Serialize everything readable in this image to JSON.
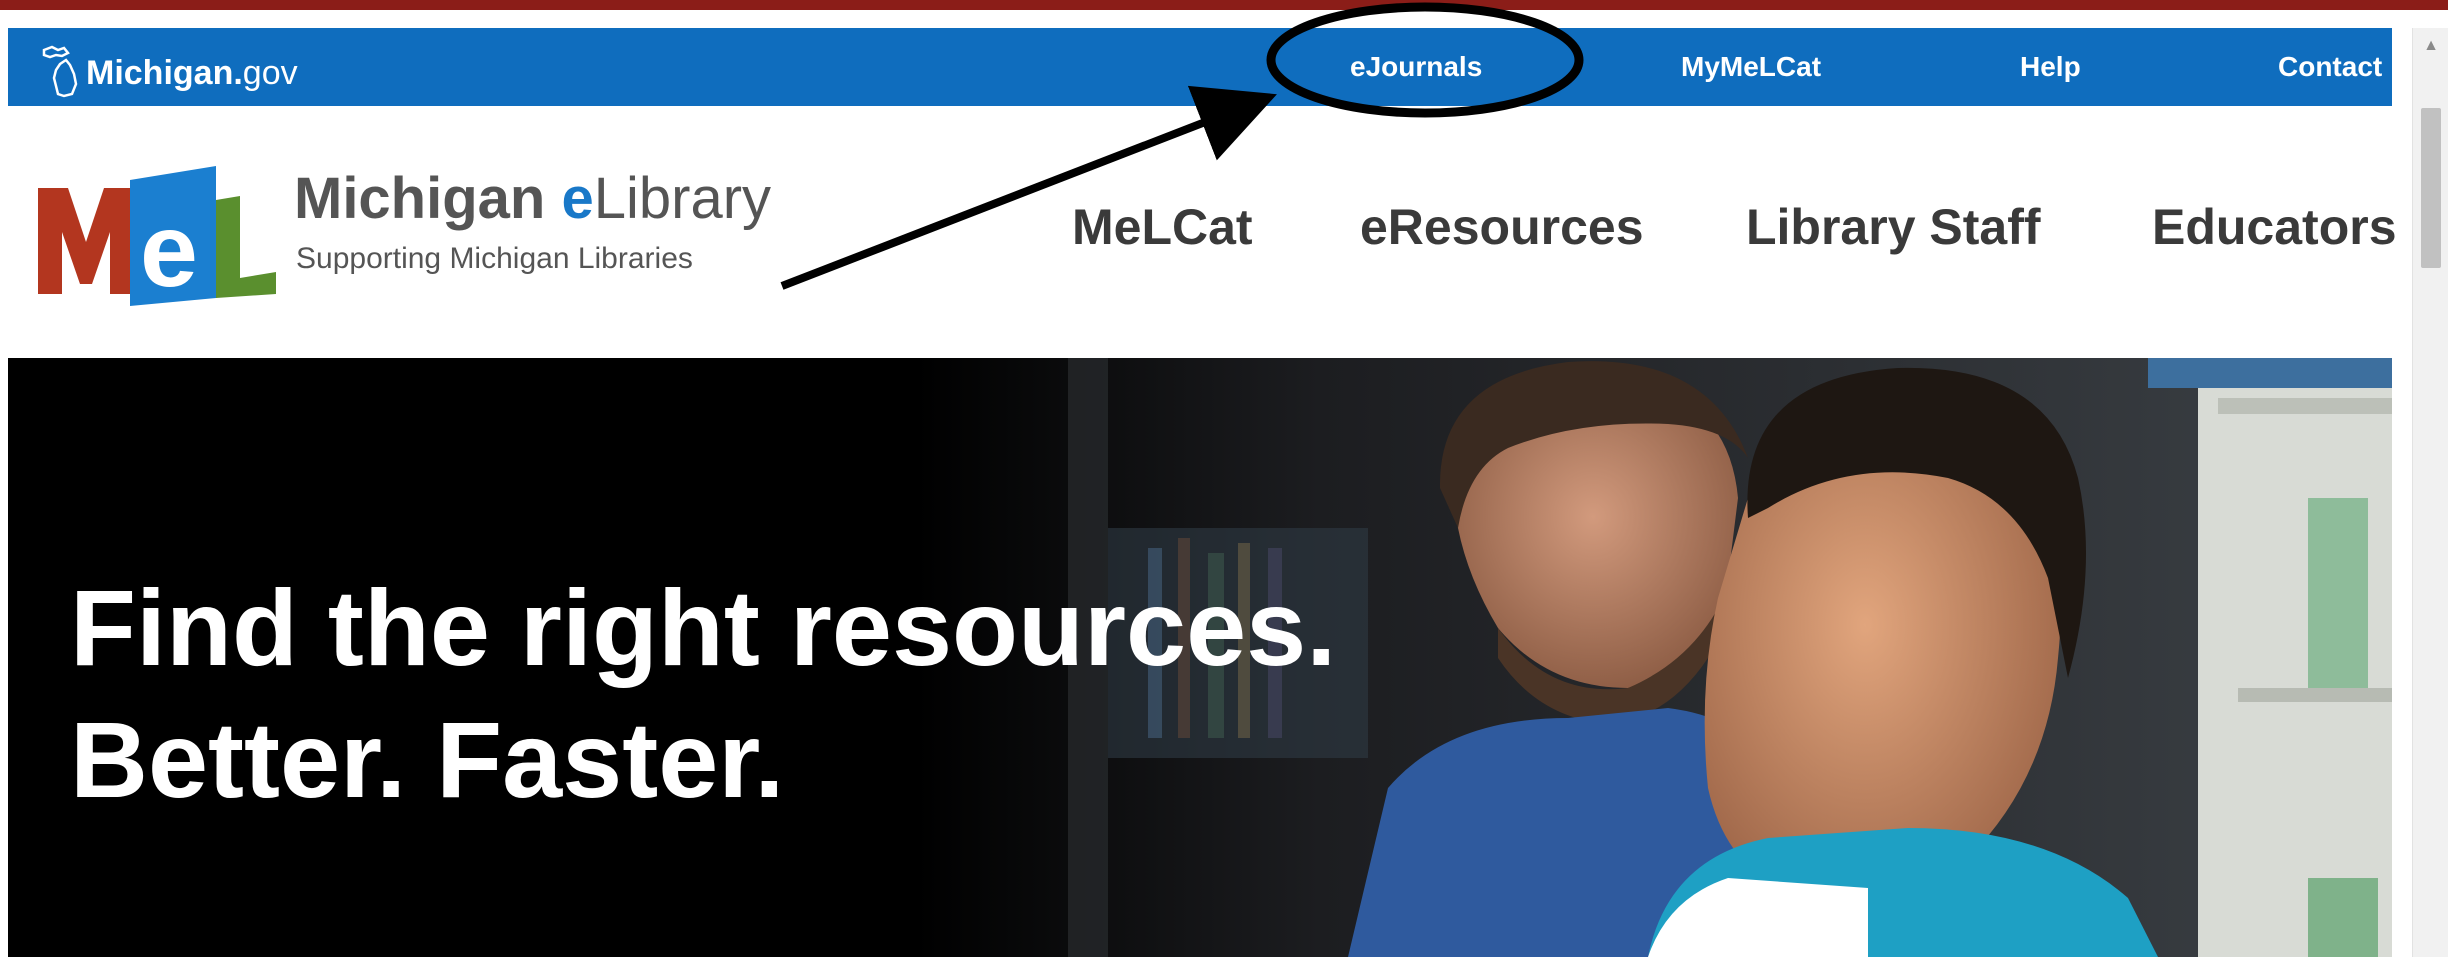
{
  "utility_bar": {
    "logo_text": "Michigan.",
    "logo_suffix": "gov",
    "links": [
      "eJournals",
      "MyMeLCat",
      "Help",
      "Contact"
    ]
  },
  "header": {
    "logo_letters": "MeL",
    "title_part1": "Michigan ",
    "title_part2": "e",
    "title_part3": "Library",
    "tagline": "Supporting Michigan Libraries",
    "nav": [
      "MeLCat",
      "eResources",
      "Library Staff",
      "Educators"
    ]
  },
  "hero": {
    "line1": "Find the right resources.",
    "line2": "Better. Faster."
  },
  "colors": {
    "top_strip": "#8b1d18",
    "utility_bar": "#0f6dbe",
    "mel_red": "#b3361f",
    "mel_blue": "#1b7fd0",
    "mel_green": "#5a8f2e",
    "annotation": "#000000"
  },
  "icons": {
    "state": "michigan-state-outline-icon",
    "scroll_up": "chevron-up-icon"
  }
}
